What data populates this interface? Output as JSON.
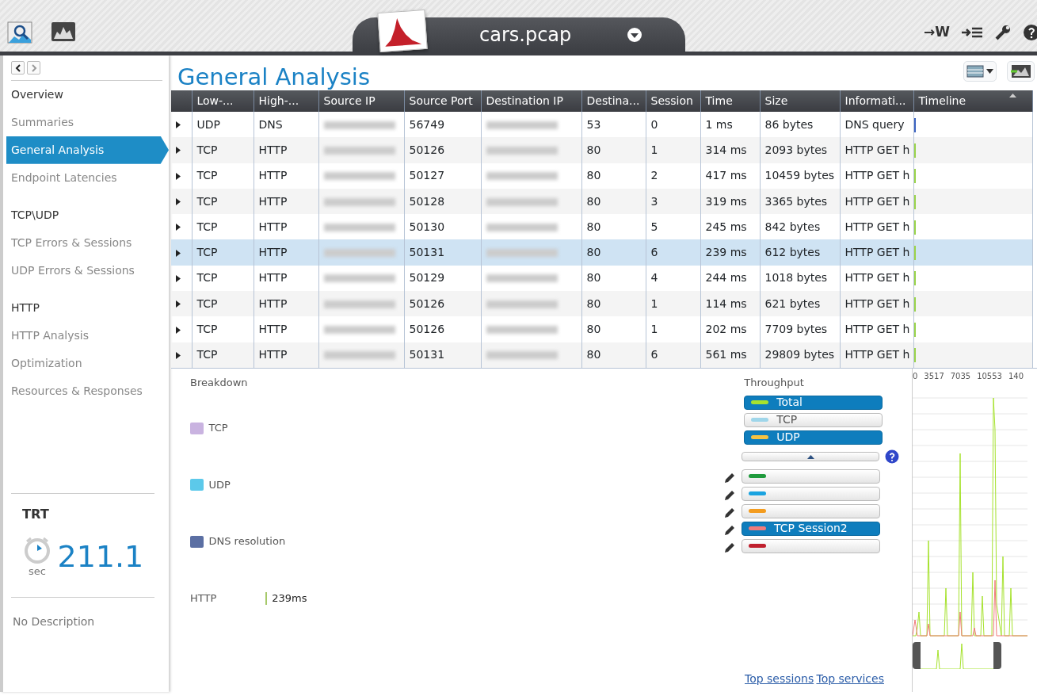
{
  "app_bar": {
    "file_tab": "cars.pcap",
    "toolbar": [
      {
        "kind": "text",
        "label": "→W"
      },
      {
        "kind": "list"
      },
      {
        "kind": "wrench"
      },
      {
        "kind": "help"
      }
    ]
  },
  "sidebar": {
    "items": [
      {
        "kind": "heading",
        "label": "Overview",
        "selected": false
      },
      {
        "kind": "item",
        "label": "Summaries",
        "selected": false
      },
      {
        "kind": "item",
        "label": "General Analysis",
        "selected": true
      },
      {
        "kind": "item",
        "label": "Endpoint Latencies",
        "selected": false
      },
      {
        "kind": "heading",
        "label": "TCP\\UDP",
        "selected": false
      },
      {
        "kind": "item",
        "label": "TCP Errors & Sessions",
        "selected": false
      },
      {
        "kind": "item",
        "label": "UDP Errors & Sessions",
        "selected": false
      },
      {
        "kind": "heading",
        "label": "HTTP",
        "selected": false
      },
      {
        "kind": "item",
        "label": "HTTP Analysis",
        "selected": false
      },
      {
        "kind": "item",
        "label": "Optimization",
        "selected": false
      },
      {
        "kind": "item",
        "label": "Resources & Responses",
        "selected": false
      }
    ],
    "metric": {
      "title": "TRT",
      "value": "211.1",
      "unit": "sec"
    },
    "description": "No Description"
  },
  "page_title": "General Analysis",
  "table": {
    "columns": [
      "Low-...",
      "High-...",
      "Source IP",
      "Source Port",
      "Destination IP",
      "Destina...",
      "Session",
      "Time",
      "Size",
      "Informati...",
      "Timeline"
    ],
    "rows": [
      {
        "selected": false,
        "color": "#3b62c0",
        "cells": [
          "UDP",
          "DNS",
          "",
          "56749",
          "",
          "53",
          "0",
          "1 ms",
          "86 bytes",
          "DNS query"
        ]
      },
      {
        "selected": false,
        "color": "#9ad34a",
        "cells": [
          "TCP",
          "HTTP",
          "",
          "50126",
          "",
          "80",
          "1",
          "314 ms",
          "2093 bytes",
          "HTTP GET h"
        ]
      },
      {
        "selected": false,
        "color": "#9ad34a",
        "cells": [
          "TCP",
          "HTTP",
          "",
          "50127",
          "",
          "80",
          "2",
          "417 ms",
          "10459 bytes",
          "HTTP GET h"
        ]
      },
      {
        "selected": false,
        "color": "#9ad34a",
        "cells": [
          "TCP",
          "HTTP",
          "",
          "50128",
          "",
          "80",
          "3",
          "319 ms",
          "3365 bytes",
          "HTTP GET h"
        ]
      },
      {
        "selected": false,
        "color": "#9ad34a",
        "cells": [
          "TCP",
          "HTTP",
          "",
          "50130",
          "",
          "80",
          "5",
          "245 ms",
          "842 bytes",
          "HTTP GET h"
        ]
      },
      {
        "selected": true,
        "color": "#9ad34a",
        "cells": [
          "TCP",
          "HTTP",
          "",
          "50131",
          "",
          "80",
          "6",
          "239 ms",
          "612 bytes",
          "HTTP GET h"
        ]
      },
      {
        "selected": false,
        "color": "#9ad34a",
        "cells": [
          "TCP",
          "HTTP",
          "",
          "50129",
          "",
          "80",
          "4",
          "244 ms",
          "1018 bytes",
          "HTTP GET h"
        ]
      },
      {
        "selected": false,
        "color": "#9ad34a",
        "cells": [
          "TCP",
          "HTTP",
          "",
          "50126",
          "",
          "80",
          "1",
          "114 ms",
          "621 bytes",
          "HTTP GET h"
        ]
      },
      {
        "selected": false,
        "color": "#9ad34a",
        "cells": [
          "TCP",
          "HTTP",
          "",
          "50126",
          "",
          "80",
          "1",
          "202 ms",
          "7709 bytes",
          "HTTP GET h"
        ]
      },
      {
        "selected": false,
        "color": "#9ad34a",
        "cells": [
          "TCP",
          "HTTP",
          "",
          "50131",
          "",
          "80",
          "6",
          "561 ms",
          "29809 bytes",
          "HTTP GET h"
        ]
      }
    ]
  },
  "breakdown": {
    "title": "Breakdown",
    "legend": [
      {
        "label": "TCP",
        "color": "#c9b3e0"
      },
      {
        "label": "UDP",
        "color": "#5cc9ea"
      },
      {
        "label": "DNS resolution",
        "color": "#5b6fa3"
      }
    ],
    "http": {
      "label": "HTTP",
      "value": "239ms"
    }
  },
  "throughput": {
    "title": "Throughput",
    "series": [
      {
        "kind": "main",
        "label": "Total",
        "color": "#a6e22e",
        "selected": true
      },
      {
        "kind": "main",
        "label": "TCP",
        "color": "#9fd6ea",
        "selected": false
      },
      {
        "kind": "main",
        "label": "UDP",
        "color": "#f5c242",
        "selected": true
      },
      {
        "kind": "session",
        "color": "#1f9a3c",
        "selected": false
      },
      {
        "kind": "session",
        "color": "#1aa3e0",
        "selected": false
      },
      {
        "kind": "session",
        "color": "#f39c1f",
        "selected": false
      },
      {
        "kind": "session",
        "label": "TCP Session2",
        "color": "#f07b7b",
        "selected": true
      },
      {
        "kind": "session",
        "color": "#c0202e",
        "selected": false
      }
    ],
    "links": [
      "Top sessions",
      "Top services"
    ],
    "axis_labels": [
      "0",
      "3517",
      "7035",
      "10553",
      "140"
    ]
  }
}
